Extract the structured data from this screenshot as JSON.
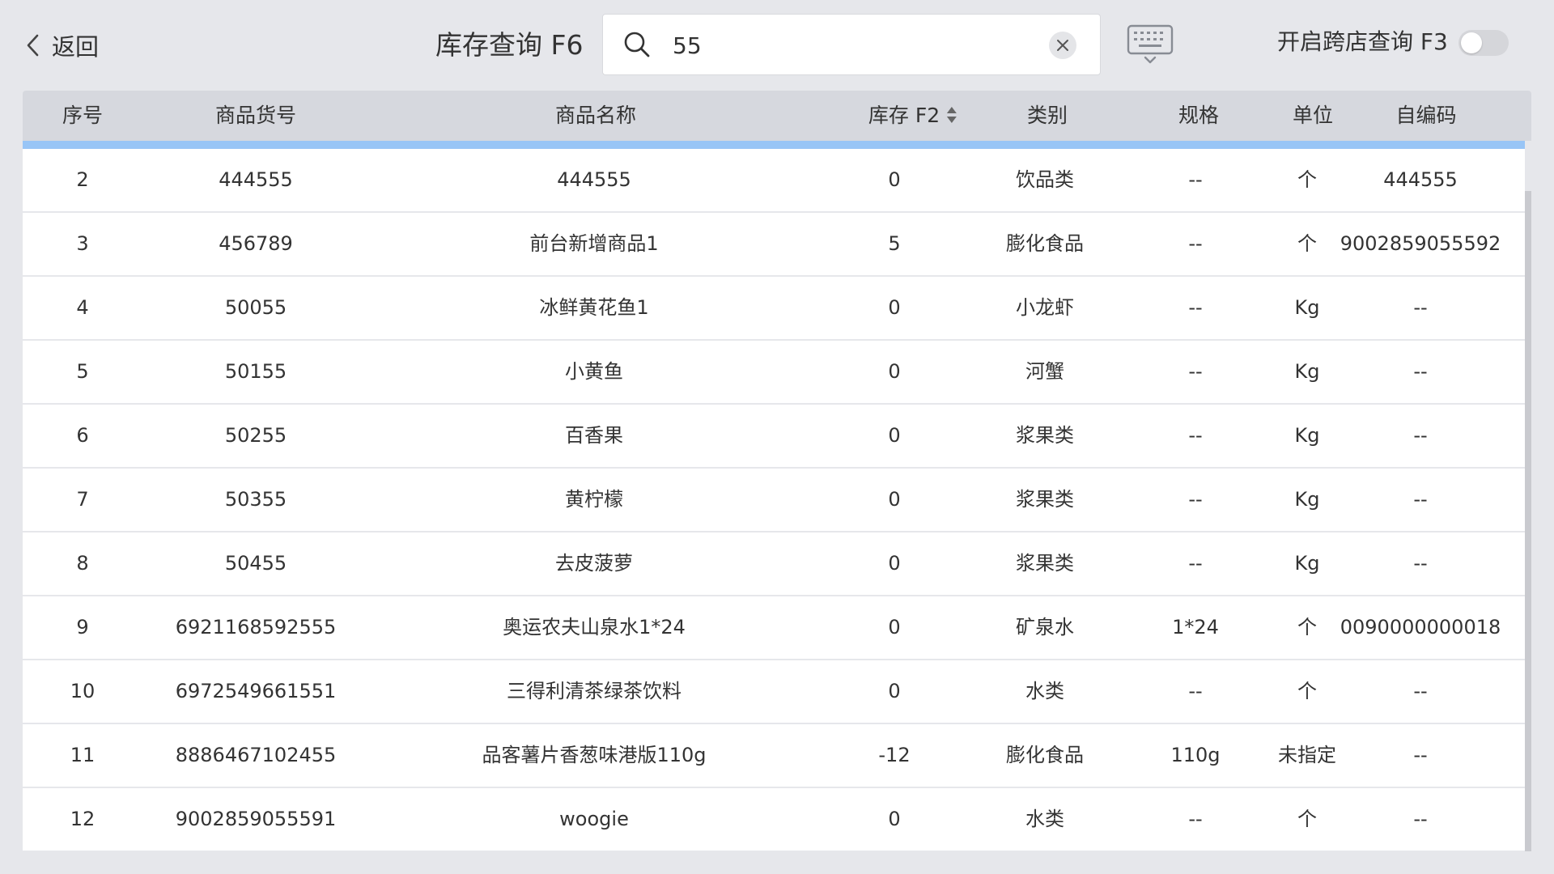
{
  "header": {
    "back_label": "返回",
    "title": "库存查询 F6",
    "search_value": "55",
    "cross_store_label": "开启跨店查询 F3",
    "cross_store_enabled": false
  },
  "table": {
    "columns": [
      "序号",
      "商品货号",
      "商品名称",
      "库存 F2",
      "类别",
      "规格",
      "单位",
      "自编码"
    ],
    "rows": [
      {
        "no": "2",
        "sku": "444555",
        "name": "444555",
        "stock": "0",
        "category": "饮品类",
        "spec": "--",
        "unit": "个",
        "code": "444555"
      },
      {
        "no": "3",
        "sku": "456789",
        "name": "前台新增商品1",
        "stock": "5",
        "category": "膨化食品",
        "spec": "--",
        "unit": "个",
        "code": "9002859055592"
      },
      {
        "no": "4",
        "sku": "50055",
        "name": "冰鲜黄花鱼1",
        "stock": "0",
        "category": "小龙虾",
        "spec": "--",
        "unit": "Kg",
        "code": "--"
      },
      {
        "no": "5",
        "sku": "50155",
        "name": "小黄鱼",
        "stock": "0",
        "category": "河蟹",
        "spec": "--",
        "unit": "Kg",
        "code": "--"
      },
      {
        "no": "6",
        "sku": "50255",
        "name": "百香果",
        "stock": "0",
        "category": "浆果类",
        "spec": "--",
        "unit": "Kg",
        "code": "--"
      },
      {
        "no": "7",
        "sku": "50355",
        "name": "黄柠檬",
        "stock": "0",
        "category": "浆果类",
        "spec": "--",
        "unit": "Kg",
        "code": "--"
      },
      {
        "no": "8",
        "sku": "50455",
        "name": "去皮菠萝",
        "stock": "0",
        "category": "浆果类",
        "spec": "--",
        "unit": "Kg",
        "code": "--"
      },
      {
        "no": "9",
        "sku": "6921168592555",
        "name": "奥运农夫山泉水1*24",
        "stock": "0",
        "category": "矿泉水",
        "spec": "1*24",
        "unit": "个",
        "code": "0090000000018"
      },
      {
        "no": "10",
        "sku": "6972549661551",
        "name": "三得利清茶绿茶饮料",
        "stock": "0",
        "category": "水类",
        "spec": "--",
        "unit": "个",
        "code": "--"
      },
      {
        "no": "11",
        "sku": "8886467102455",
        "name": "品客薯片香葱味港版110g",
        "stock": "-12",
        "category": "膨化食品",
        "spec": "110g",
        "unit": "未指定",
        "code": "--"
      },
      {
        "no": "12",
        "sku": "9002859055591",
        "name": "woogie",
        "stock": "0",
        "category": "水类",
        "spec": "--",
        "unit": "个",
        "code": "--"
      }
    ]
  },
  "colors": {
    "background": "#e6e7eb",
    "header_row": "#d6d8de",
    "accent_bar": "#98c5f6",
    "row_bg": "#ffffff",
    "text": "#333333"
  }
}
